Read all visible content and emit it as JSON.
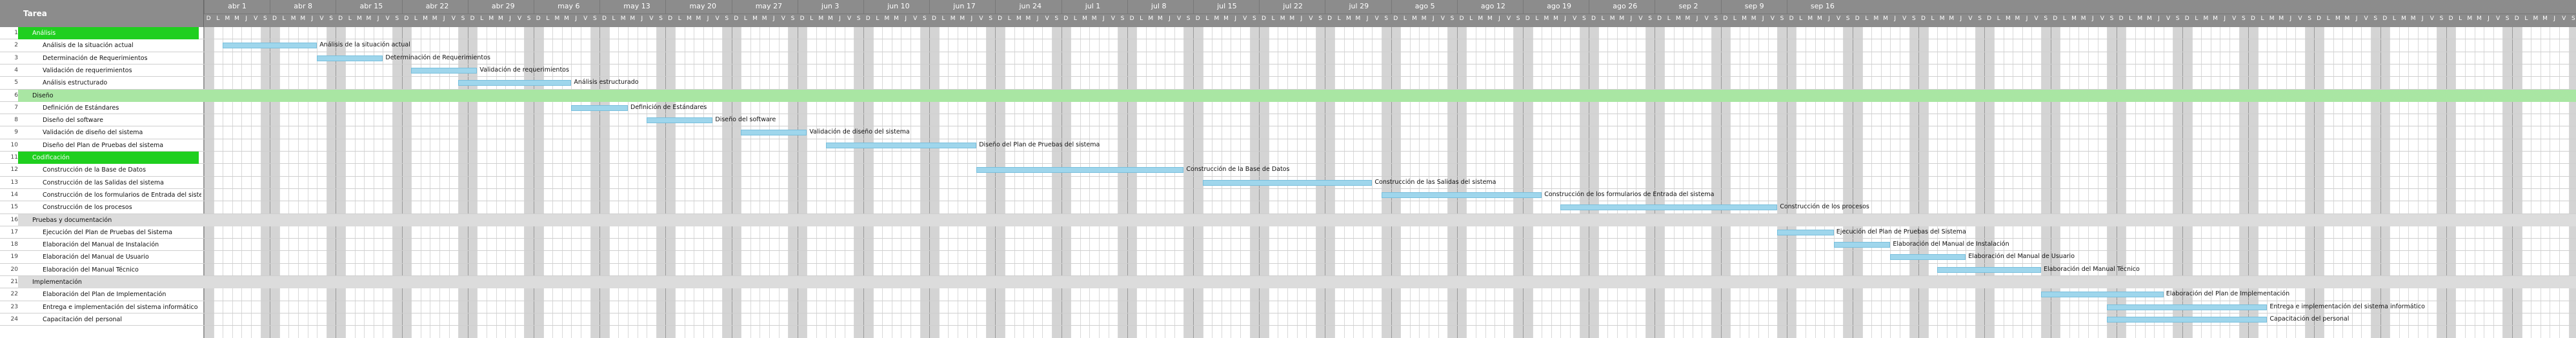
{
  "header": {
    "task_label": "Tarea"
  },
  "timeline": {
    "weeks": [
      "abr 1",
      "abr 8",
      "abr 15",
      "abr 22",
      "abr 29",
      "may 6",
      "may 13",
      "may 20",
      "may 27",
      "jun 3",
      "jun 10",
      "jun 17",
      "jun 24",
      "jul 1",
      "jul 8",
      "jul 15",
      "jul 22",
      "jul 29",
      "ago 5",
      "ago 12",
      "ago 19",
      "ago 26",
      "sep 2",
      "sep 9",
      "sep 16"
    ],
    "day_letters": [
      "D",
      "L",
      "M",
      "M",
      "J",
      "V",
      "S"
    ]
  },
  "colors": {
    "header_gray": "#8c8c8c",
    "weekend_gray": "#d4d4d4",
    "group_green_strong": "#1fcf1f",
    "group_green_light": "#a9e6a3",
    "group_gray": "#dcdcdc",
    "bar_blue": "#9fd6ec"
  },
  "rows": [
    {
      "num": "1",
      "name": "Análisis",
      "group": "strong"
    },
    {
      "num": "2",
      "name": "Análisis de la situación actual",
      "bar_label": "Análisis de la situación actual",
      "start": "abr 2",
      "end": "abr 12"
    },
    {
      "num": "3",
      "name": "Determinación de Requerimientos",
      "bar_label": "Determinación de Requerimientos",
      "start": "abr 12",
      "end": "abr 19"
    },
    {
      "num": "4",
      "name": "Validación de requerimientos",
      "bar_label": "Validación de requerimientos",
      "start": "abr 22",
      "end": "abr 29"
    },
    {
      "num": "5",
      "name": "Análisis estructurado",
      "bar_label": "Análisis estructurado",
      "start": "abr 27",
      "end": "may 9"
    },
    {
      "num": "6",
      "name": "Diseño",
      "group": "light"
    },
    {
      "num": "7",
      "name": "Definición de Estándares",
      "bar_label": "Definición de Estándares",
      "start": "may 9",
      "end": "may 15"
    },
    {
      "num": "8",
      "name": "Diseño del software",
      "bar_label": "Diseño del software",
      "start": "may 17",
      "end": "may 24"
    },
    {
      "num": "9",
      "name": "Validación de diseño del sistema",
      "bar_label": "Validación de diseño del sistema",
      "start": "may 27",
      "end": "jun 3"
    },
    {
      "num": "10",
      "name": "Diseño del Plan de Pruebas del sistema",
      "bar_label": "Diseño del Plan de Pruebas del sistema",
      "start": "jun 5",
      "end": "jun 21"
    },
    {
      "num": "11",
      "name": "Codificación",
      "group": "strong"
    },
    {
      "num": "12",
      "name": "Construcción de la Base de Datos",
      "bar_label": "Construcción de la Base de Datos",
      "start": "jun 21",
      "end": "jul 13"
    },
    {
      "num": "13",
      "name": "Construcción de las Salidas del sistema",
      "bar_label": "Construcción de las Salidas del sistema",
      "start": "jul 15",
      "end": "aug 2"
    },
    {
      "num": "14",
      "name": "Construcción de los formularios de Entrada del sistema",
      "bar_label": "Construcción de los formularios de Entrada del sistema",
      "start": "aug 3",
      "end": "aug 20"
    },
    {
      "num": "15",
      "name": "Construcción de los procesos",
      "bar_label": "Construcción de los procesos",
      "start": "aug 22",
      "end": "sep 14"
    },
    {
      "num": "16",
      "name": "Pruebas y documentación",
      "group": "gray"
    },
    {
      "num": "17",
      "name": "Ejecución del Plan de Pruebas del Sistema",
      "bar_label": "Ejecución del Plan de Pruebas del Sistema",
      "start": "sep 14",
      "end": "sep 20"
    },
    {
      "num": "18",
      "name": "Elaboración del Manual de Instalación",
      "bar_label": "Elaboración del Manual de Instalación",
      "start": "sep 20",
      "end": "sep 26"
    },
    {
      "num": "19",
      "name": "Elaboración del Manual de Usuario",
      "bar_label": "Elaboración del Manual de Usuario",
      "start": "sep 26",
      "end": "oct 4"
    },
    {
      "num": "20",
      "name": "Elaboración del Manual Técnico",
      "bar_label": "Elaboración del Manual Técnico",
      "start": "oct 1",
      "end": "oct 12"
    },
    {
      "num": "21",
      "name": "Implementación",
      "group": "gray"
    },
    {
      "num": "22",
      "name": "Elaboración del Plan de Implementación",
      "bar_label": "Elaboración del Plan de Implementación",
      "start": "oct 12",
      "end": "oct 25"
    },
    {
      "num": "23",
      "name": "Entrega e implementación del sistema informático",
      "bar_label": "Entrega e implementación del sistema informático",
      "start": "oct 19",
      "end": "nov 5"
    },
    {
      "num": "24",
      "name": "Capacitación del personal",
      "bar_label": "Capacitación del personal",
      "start": "oct 19",
      "end": "nov 5"
    }
  ]
}
